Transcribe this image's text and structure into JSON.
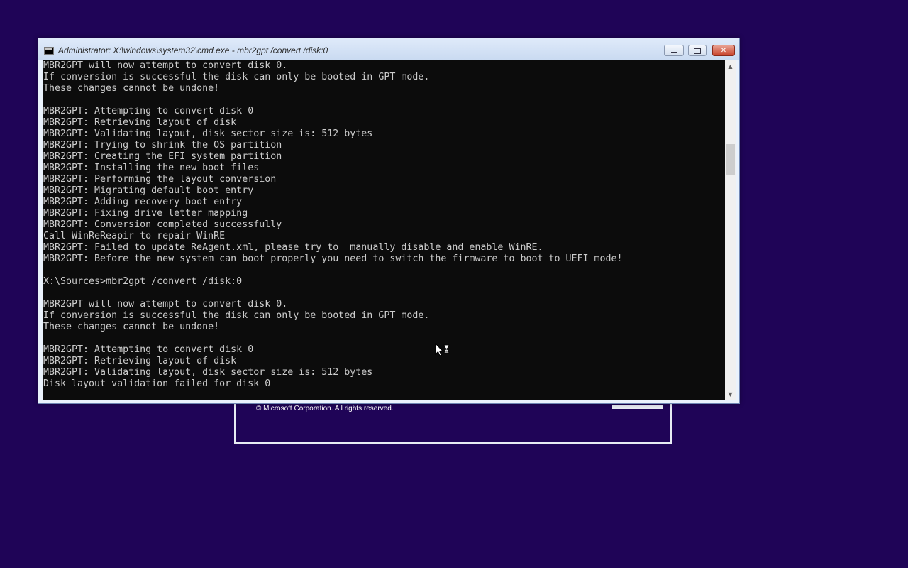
{
  "setup": {
    "copyright": "© Microsoft Corporation. All rights reserved."
  },
  "cmd": {
    "title": "Administrator: X:\\windows\\system32\\cmd.exe - mbr2gpt  /convert /disk:0",
    "lines": [
      "MBR2GPT will now attempt to convert disk 0.",
      "If conversion is successful the disk can only be booted in GPT mode.",
      "These changes cannot be undone!",
      "",
      "MBR2GPT: Attempting to convert disk 0",
      "MBR2GPT: Retrieving layout of disk",
      "MBR2GPT: Validating layout, disk sector size is: 512 bytes",
      "MBR2GPT: Trying to shrink the OS partition",
      "MBR2GPT: Creating the EFI system partition",
      "MBR2GPT: Installing the new boot files",
      "MBR2GPT: Performing the layout conversion",
      "MBR2GPT: Migrating default boot entry",
      "MBR2GPT: Adding recovery boot entry",
      "MBR2GPT: Fixing drive letter mapping",
      "MBR2GPT: Conversion completed successfully",
      "Call WinReReapir to repair WinRE",
      "MBR2GPT: Failed to update ReAgent.xml, please try to  manually disable and enable WinRE.",
      "MBR2GPT: Before the new system can boot properly you need to switch the firmware to boot to UEFI mode!",
      "",
      "X:\\Sources>mbr2gpt /convert /disk:0",
      "",
      "MBR2GPT will now attempt to convert disk 0.",
      "If conversion is successful the disk can only be booted in GPT mode.",
      "These changes cannot be undone!",
      "",
      "MBR2GPT: Attempting to convert disk 0",
      "MBR2GPT: Retrieving layout of disk",
      "MBR2GPT: Validating layout, disk sector size is: 512 bytes",
      "Disk layout validation failed for disk 0"
    ]
  },
  "icons": {
    "cmd_icon": "command-prompt-icon",
    "minimize": "minimize-icon",
    "maximize": "maximize-icon",
    "close": "close-icon",
    "scroll_up": "chevron-up-icon",
    "scroll_down": "chevron-down-icon",
    "cursor": "busy-cursor-icon"
  },
  "colors": {
    "desktop_background": "#1f0457",
    "console_background": "#0c0c0c",
    "console_text": "#cccccc",
    "close_button": "#c8432b"
  }
}
